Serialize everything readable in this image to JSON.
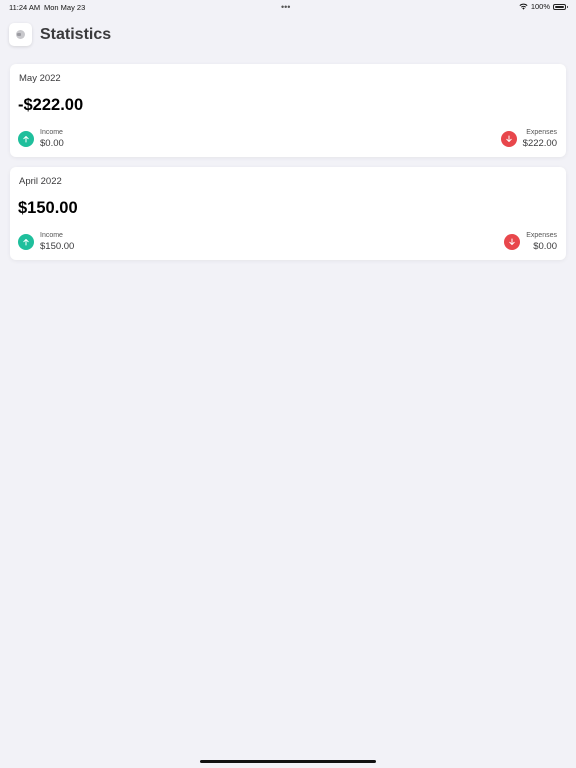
{
  "status_bar": {
    "time": "11:24 AM",
    "date": "Mon May 23",
    "battery": "100%"
  },
  "header": {
    "title": "Statistics"
  },
  "cards": [
    {
      "month": "May 2022",
      "balance": "-$222.00",
      "income_label": "Income",
      "income_value": "$0.00",
      "expenses_label": "Expenses",
      "expenses_value": "$222.00"
    },
    {
      "month": "April 2022",
      "balance": "$150.00",
      "income_label": "Income",
      "income_value": "$150.00",
      "expenses_label": "Expenses",
      "expenses_value": "$0.00"
    }
  ],
  "colors": {
    "income": "#1fbf9c",
    "expenses": "#e8474c",
    "background": "#f2f2f7"
  },
  "icons": {
    "income": "arrow-up-icon",
    "expenses": "arrow-down-icon",
    "menu": "sidebar-toggle-icon"
  }
}
